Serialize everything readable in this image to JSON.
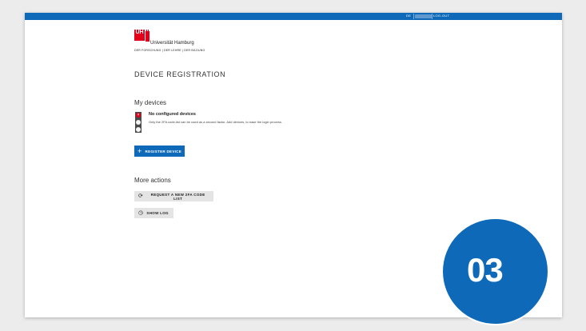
{
  "topbar": {
    "language": "DE",
    "logout_label": "LOG-OUT"
  },
  "logo": {
    "mark": "UH",
    "name": "Universität Hamburg",
    "tagline": "DER FORSCHUNG | DER LEHRE | DER BILDUNG"
  },
  "page_title": "DEVICE REGISTRATION",
  "my_devices": {
    "heading": "My devices",
    "status_title": "No configured devices",
    "status_text": "Only the 2FA code-list can be used as a second factor. Add devices, to ease the login process.",
    "register_button": "REGISTER DEVICE"
  },
  "more_actions": {
    "heading": "More actions",
    "request_code_list_button": "REQUEST A NEW 2FA CODE LIST",
    "show_log_button": "SHOW LOG"
  },
  "step_badge": "03",
  "colors": {
    "accent": "#0e6ab8",
    "brand_red": "#e2001a"
  }
}
